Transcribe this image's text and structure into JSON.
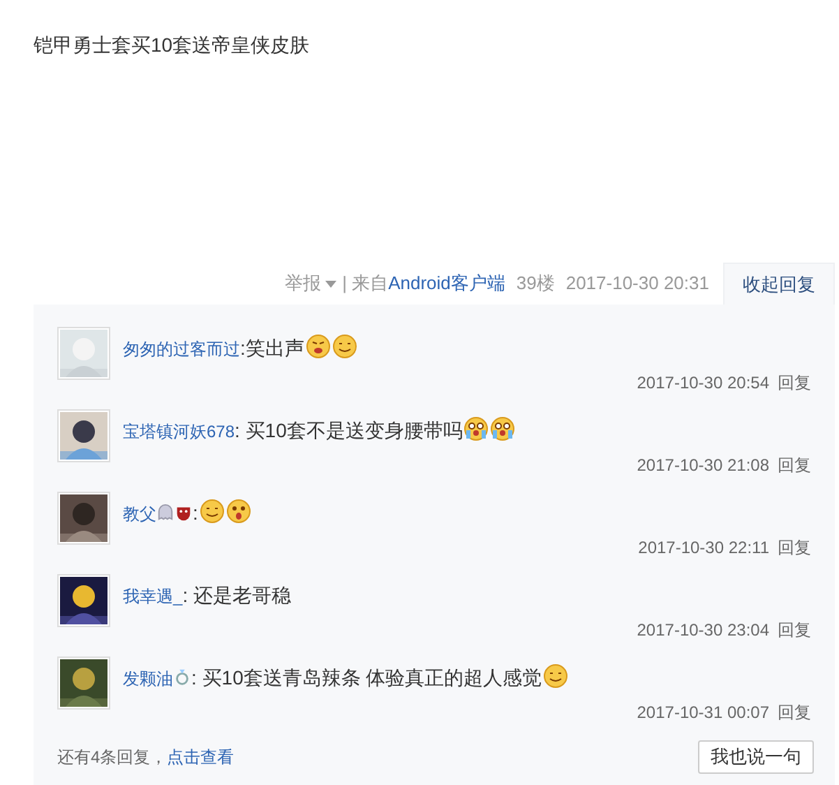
{
  "post": {
    "text": "铠甲勇士套买10套送帝皇侠皮肤"
  },
  "meta": {
    "report": "举报",
    "source_prefix": "| 来自",
    "source_link": "Android客户端",
    "floor": "39楼",
    "time": "2017-10-30 20:31",
    "toggle": "收起回复"
  },
  "replies": [
    {
      "user": "匆匆的过客而过",
      "text": ":笑出声",
      "emoticons": [
        {
          "kind": "angry"
        },
        {
          "kind": "smile"
        }
      ],
      "time": "2017-10-30 20:54",
      "reply": "回复"
    },
    {
      "user": "宝塔镇河妖678",
      "text": ": 买10套不是送变身腰带吗",
      "emoticons": [
        {
          "kind": "cry"
        },
        {
          "kind": "cry"
        }
      ],
      "time": "2017-10-30 21:08",
      "reply": "回复"
    },
    {
      "user": "教父",
      "badges": [
        {
          "kind": "ghost"
        },
        {
          "kind": "mask"
        }
      ],
      "text": ":",
      "emoticons": [
        {
          "kind": "smile"
        },
        {
          "kind": "shock"
        }
      ],
      "time": "2017-10-30 22:11",
      "reply": "回复"
    },
    {
      "user": "我幸遇_",
      "text": ": 还是老哥稳",
      "time": "2017-10-30 23:04",
      "reply": "回复"
    },
    {
      "user": "发颗油",
      "badges": [
        {
          "kind": "ring"
        }
      ],
      "text": ": 买10套送青岛辣条 体验真正的超人感觉",
      "emoticons": [
        {
          "kind": "smile"
        }
      ],
      "time": "2017-10-31 00:07",
      "reply": "回复"
    }
  ],
  "footer": {
    "more_prefix": "还有4条回复，",
    "more_link": "点击查看",
    "button": "我也说一句"
  }
}
